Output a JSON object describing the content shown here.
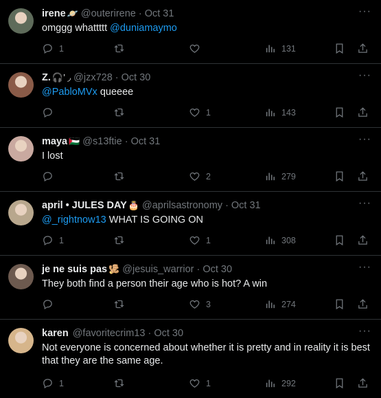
{
  "tweets": [
    {
      "name": "irene",
      "emoji": "🪐",
      "handle": "@outerirene",
      "dot": "·",
      "date": "Oct 31",
      "text_parts": [
        "omggg whattttt",
        "@duniamaymo"
      ],
      "mention_first": false,
      "replies": "1",
      "retweets": "",
      "likes": "",
      "views": "131",
      "avatar_color": "#5e6b5a"
    },
    {
      "name": "Z.",
      "emoji": "🎧’ ◞",
      "handle": "@jzx728",
      "dot": "·",
      "date": "Oct 30",
      "text_parts": [
        "@PabloMVx",
        "queeee"
      ],
      "mention_first": true,
      "replies": "",
      "retweets": "",
      "likes": "1",
      "views": "143",
      "avatar_color": "#8a5b48"
    },
    {
      "name": "maya",
      "emoji": "🇵🇸",
      "handle": "@s13ftie",
      "dot": "·",
      "date": "Oct 31",
      "text_parts": [
        "I lost"
      ],
      "mention_first": false,
      "replies": "",
      "retweets": "",
      "likes": "2",
      "views": "279",
      "avatar_color": "#c9a9a0"
    },
    {
      "name": "april • JULES DAY",
      "emoji": "🎂",
      "handle": "@aprilsastronomy",
      "dot": "·",
      "date": "Oct 31",
      "text_parts": [
        "@_rightnow13",
        "WHAT IS GOING ON"
      ],
      "mention_first": true,
      "replies": "1",
      "retweets": "",
      "likes": "1",
      "views": "308",
      "avatar_color": "#b8a78d"
    },
    {
      "name": "je ne suis pas",
      "emoji": "🫚",
      "handle": "@jesuis_warrior",
      "dot": "·",
      "date": "Oct 30",
      "text_parts": [
        "They both find a person their age who is hot?  A win"
      ],
      "mention_first": false,
      "replies": "",
      "retweets": "",
      "likes": "3",
      "views": "274",
      "avatar_color": "#6d5a4f"
    },
    {
      "name": "karen",
      "emoji": "",
      "handle": "@favoritecrim13",
      "dot": "·",
      "date": "Oct 30",
      "text_parts": [
        "Not everyone is concerned about whether it is pretty and in reality it is best that they are the same age."
      ],
      "mention_first": false,
      "replies": "1",
      "retweets": "",
      "likes": "1",
      "views": "292",
      "avatar_color": "#d6b58b"
    }
  ],
  "more_label": "···"
}
